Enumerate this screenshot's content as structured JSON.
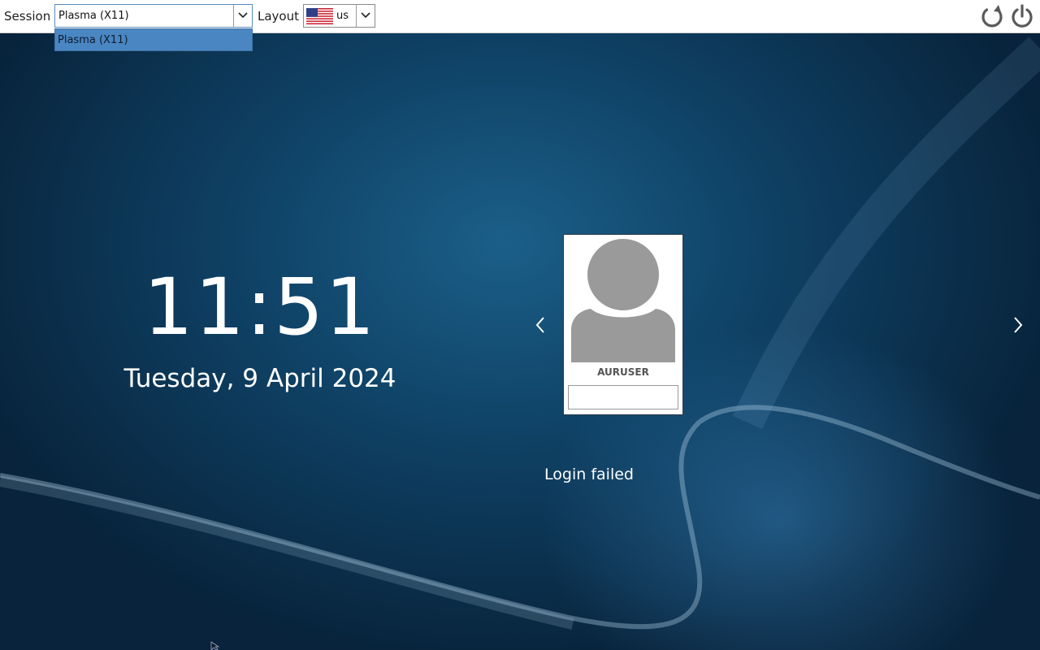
{
  "topbar": {
    "session_label": "Session",
    "session_value": "Plasma (X11)",
    "session_options": [
      "Plasma (X11)"
    ],
    "layout_label": "Layout",
    "layout_value": "us",
    "layout_flag_icon": "us-flag-icon",
    "reboot_icon": "reboot-icon",
    "shutdown_icon": "power-icon"
  },
  "clock": {
    "time": "11:51",
    "date": "Tuesday, 9 April 2024"
  },
  "user": {
    "name": "AURUSER",
    "password_value": "",
    "avatar_icon": "user-avatar-icon"
  },
  "message": "Login failed",
  "colors": {
    "background": "#0f4266",
    "dropdown_highlight": "#4a86c2",
    "text": "#ffffff"
  }
}
